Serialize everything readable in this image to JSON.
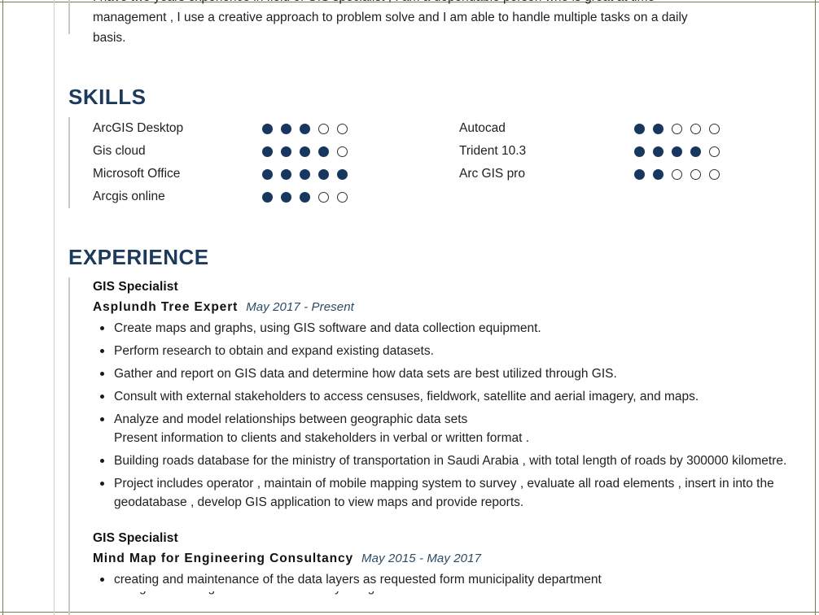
{
  "document": {
    "type": "resume",
    "accent_color": "#1b3a5c",
    "dot_filled_color": "#17375e",
    "frame_color": "#7d7a46"
  },
  "summary": {
    "clipped_top_line": "I have two years experience in field of GIS specialist , I am a dependable person who is great at time",
    "line_2": "management , I use a creative approach to problem solve and I am able to handle multiple tasks on a daily",
    "line_3": "basis."
  },
  "skills": {
    "heading": "SKILLS",
    "max_rating": 5,
    "left_column": [
      {
        "name": "ArcGIS Desktop",
        "rating": 3
      },
      {
        "name": "Gis cloud",
        "rating": 4
      },
      {
        "name": "Microsoft Office",
        "rating": 5
      },
      {
        "name": "Arcgis online",
        "rating": 3
      }
    ],
    "right_column": [
      {
        "name": "Autocad",
        "rating": 2
      },
      {
        "name": "Trident 10.3",
        "rating": 4
      },
      {
        "name": "Arc GIS pro",
        "rating": 2
      }
    ]
  },
  "experience": {
    "heading": "EXPERIENCE",
    "jobs": [
      {
        "title": "GIS Specialist",
        "company": "Asplundh Tree Expert",
        "dates": "May 2017 - Present",
        "bullets": [
          {
            "text": "Create maps and graphs, using GIS software and data collection equipment."
          },
          {
            "text": "Perform research to obtain and expand existing datasets."
          },
          {
            "text": "Gather and report on GIS data and determine how data sets are best utilized through GIS."
          },
          {
            "text": "Consult with external stakeholders to access censuses, fieldwork, satellite and aerial imagery, and maps."
          },
          {
            "text": "Analyze and model relationships between geographic data sets",
            "subline": "Present information to clients and stakeholders in verbal or written format ."
          },
          {
            "text": "Building roads database for the ministry of transportation in Saudi Arabia , with total length of roads by 300000 kilometre."
          },
          {
            "text": "Project includes operator , maintain of mobile mapping system to survey , evaluate all road elements , insert in into the geodatabase , develop GIS application to view maps and provide reports."
          }
        ]
      },
      {
        "title": "GIS Specialist",
        "company": "Mind Map for Engineering Consultancy",
        "dates": "May 2015 - May 2017",
        "bullets": [
          {
            "text": "creating and maintenance of the data layers as requested form municipality department"
          }
        ],
        "clipped_bullet": "Designed drawings of different assembly using Auto CAD"
      }
    ]
  }
}
